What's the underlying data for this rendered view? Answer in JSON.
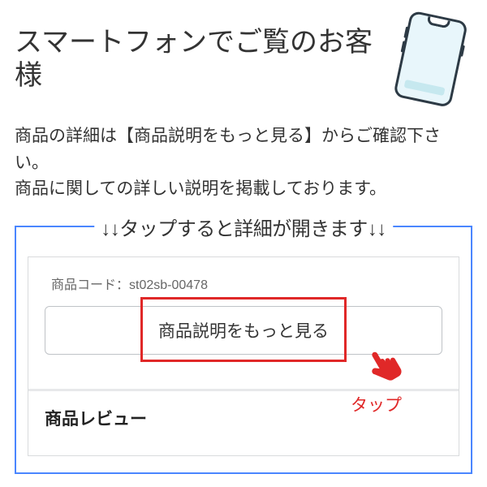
{
  "heading": "スマートフォンでご覧のお客様",
  "description_line1": "商品の詳細は【商品説明をもっと見る】からご確認下さい。",
  "description_line2": "商品に関しての詳しい説明を掲載しております。",
  "frame_label": "↓↓タップすると詳細が開きます↓↓",
  "product_code_label": "商品コード：",
  "product_code_value": "st02sb-00478",
  "more_button": "商品説明をもっと見る",
  "hand_caption": "タップ",
  "review_heading": "商品レビュー"
}
